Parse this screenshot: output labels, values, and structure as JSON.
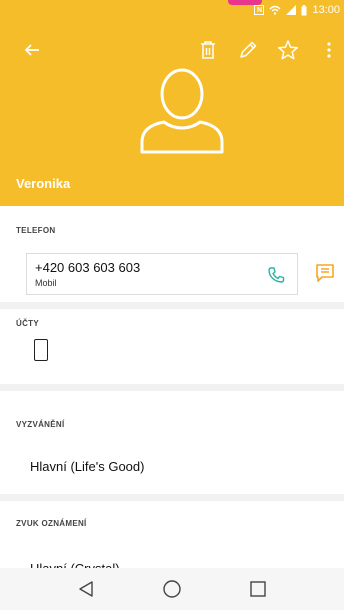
{
  "status": {
    "time": "13:00",
    "nfc": "N"
  },
  "header": {
    "contact_name": "Veronika",
    "icons": [
      "back-arrow-icon",
      "delete-icon",
      "edit-icon",
      "favorite-star-icon",
      "more-vert-icon"
    ],
    "color": "#f5bd2a"
  },
  "sections": {
    "phone": {
      "label": "TELEFON",
      "number": "+420 603 603 603",
      "type": "Mobil"
    },
    "accounts": {
      "label": "ÚČTY"
    },
    "ringtone": {
      "label": "VYZVÁNĚNÍ",
      "value": "Hlavní (Life's Good)"
    },
    "notification_sound": {
      "label": "ZVUK OZNÁMENÍ",
      "value": "Hlavní (Crystal)"
    }
  },
  "colors": {
    "accent_orange": "#f5a623",
    "call_green": "#2ab3a2"
  }
}
